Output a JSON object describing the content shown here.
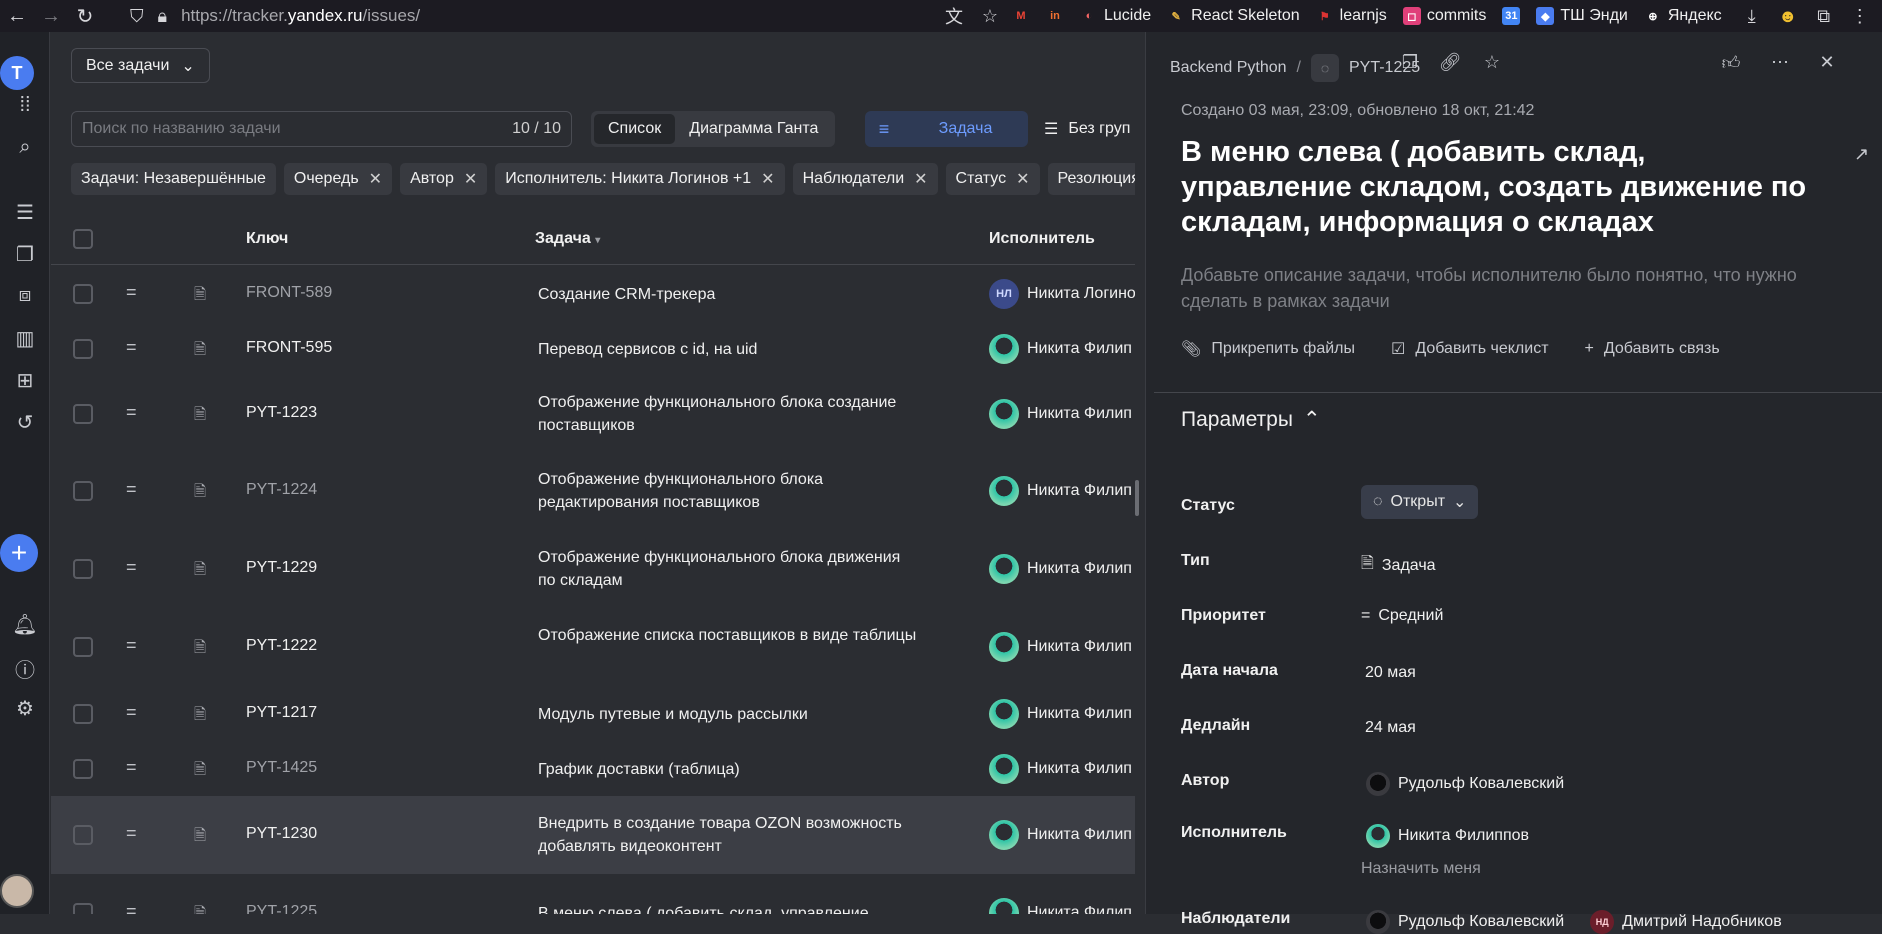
{
  "browser": {
    "url_prefix": "https://tracker.",
    "url_domain": "yandex.ru",
    "url_path": "/issues/",
    "bookmarks": [
      {
        "label": "Lucide",
        "color": "#f56565",
        "glyph": "◐"
      },
      {
        "label": "React Skeleton",
        "color": "#e0b040",
        "glyph": "✎"
      },
      {
        "label": "learnjs",
        "color": "#d33",
        "glyph": "⚑"
      },
      {
        "label": "commits",
        "color": "#e0407a",
        "glyph": "◻"
      },
      {
        "label": "ТШ Энди",
        "color": "#4a7cf0",
        "glyph": "◆"
      },
      {
        "label": "Яндекс",
        "color": "#ffffff",
        "glyph": "⊕"
      }
    ],
    "calendar_badge": "31"
  },
  "main": {
    "all_tasks_label": "Все задачи",
    "search": {
      "placeholder": "Поиск по названию задачи",
      "count": "10 / 10"
    },
    "view_tabs": [
      "Список",
      "Диаграмма Ганта"
    ],
    "task_button": "Задача",
    "group_button": "Без груп",
    "filters": [
      {
        "label": "Задачи: Незавершённые",
        "closable": false
      },
      {
        "label": "Очередь",
        "closable": true
      },
      {
        "label": "Автор",
        "closable": true
      },
      {
        "label": "Исполнитель: Никита Логинов +1",
        "closable": true
      },
      {
        "label": "Наблюдатели",
        "closable": true
      },
      {
        "label": "Статус",
        "closable": true
      },
      {
        "label": "Резолюция",
        "closable": false
      }
    ],
    "columns": {
      "key": "Ключ",
      "task": "Задача",
      "assignee": "Исполнитель"
    },
    "rows": [
      {
        "key": "FRONT-589",
        "dim": true,
        "title": "Создание CRM-трекера",
        "assignee": "Никита Логино",
        "avatar": "nl",
        "initials": "НЛ"
      },
      {
        "key": "FRONT-595",
        "dim": false,
        "title": "Перевод сервисов с id, на uid",
        "assignee": "Никита Филип",
        "avatar": "teal",
        "initials": ""
      },
      {
        "key": "PYT-1223",
        "dim": false,
        "title": "Отображение функционального блока создание поставщиков",
        "assignee": "Никита Филип",
        "avatar": "teal",
        "initials": ""
      },
      {
        "key": "PYT-1224",
        "dim": true,
        "title": "Отображение функционального блока редактирования поставщиков",
        "assignee": "Никита Филип",
        "avatar": "teal",
        "initials": ""
      },
      {
        "key": "PYT-1229",
        "dim": false,
        "title": "Отображение функционального блока движения по складам",
        "assignee": "Никита Филип",
        "avatar": "teal",
        "initials": ""
      },
      {
        "key": "PYT-1222",
        "dim": false,
        "title": "Отображение списка поставщиков в виде таблицы",
        "assignee": "Никита Филип",
        "avatar": "teal",
        "initials": ""
      },
      {
        "key": "PYT-1217",
        "dim": false,
        "title": "Модуль путевые и модуль рассылки",
        "assignee": "Никита Филип",
        "avatar": "teal",
        "initials": ""
      },
      {
        "key": "PYT-1425",
        "dim": true,
        "title": "График доставки (таблица)",
        "assignee": "Никита Филип",
        "avatar": "teal",
        "initials": ""
      },
      {
        "key": "PYT-1230",
        "dim": false,
        "title": "Внедрить в создание товара OZON возможность добавлять видеоконтент",
        "assignee": "Никита Филип",
        "avatar": "teal",
        "initials": ""
      },
      {
        "key": "PYT-1225",
        "dim": true,
        "title": "В меню слева ( добавить склад, управление",
        "assignee": "Никита Филип",
        "avatar": "teal",
        "initials": ""
      }
    ]
  },
  "panel": {
    "queue": "Backend Python",
    "separator": "/",
    "issue_key": "PYT-1225",
    "created": "Создано 03 мая, 23:09, обновлено 18 окт, 21:42",
    "title": "В меню слева ( добавить склад, управление складом, создать движение по складам, информация о складах",
    "description_placeholder": "Добавьте описание задачи, чтобы исполнителю было понятно, что нужно сделать в рамках задачи",
    "actions": [
      "Прикрепить файлы",
      "Добавить чеклист",
      "Добавить связь"
    ],
    "params_title": "Параметры",
    "fields": {
      "status_label": "Статус",
      "status_value": "Открыт",
      "type_label": "Тип",
      "type_value": "Задача",
      "priority_label": "Приоритет",
      "priority_value": "Средний",
      "start_label": "Дата начала",
      "start_value": "20 мая",
      "deadline_label": "Дедлайн",
      "deadline_value": "24 мая",
      "author_label": "Автор",
      "author_value": "Рудольф Ковалевский",
      "assignee_label": "Исполнитель",
      "assignee_value": "Никита Филиппов",
      "assign_me": "Назначить меня",
      "watchers_label": "Наблюдатели",
      "watchers": [
        {
          "name": "Рудольф Ковалевский",
          "avatar": "dark",
          "initials": ""
        },
        {
          "name": "Дмитрий Надобников",
          "avatar": "nd",
          "initials": "НД"
        }
      ]
    }
  }
}
